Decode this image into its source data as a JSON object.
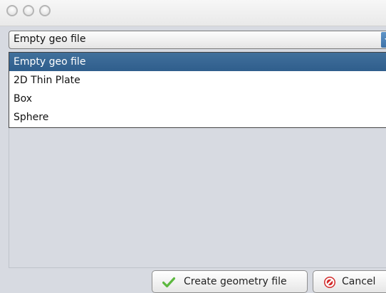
{
  "combo": {
    "selected_value": "Empty geo file"
  },
  "options": [
    {
      "label": "Empty geo file",
      "selected": true
    },
    {
      "label": "2D Thin Plate",
      "selected": false
    },
    {
      "label": "Box",
      "selected": false
    },
    {
      "label": "Sphere",
      "selected": false
    }
  ],
  "buttons": {
    "create_label": "Create geometry file",
    "cancel_label": "Cancel"
  },
  "icons": {
    "create": "checkmark-icon",
    "cancel": "prohibited-icon"
  },
  "colors": {
    "selection": "#3a6895",
    "checkmark": "#5cb83f",
    "cancel": "#d22a2a",
    "background": "#d7dae1"
  }
}
